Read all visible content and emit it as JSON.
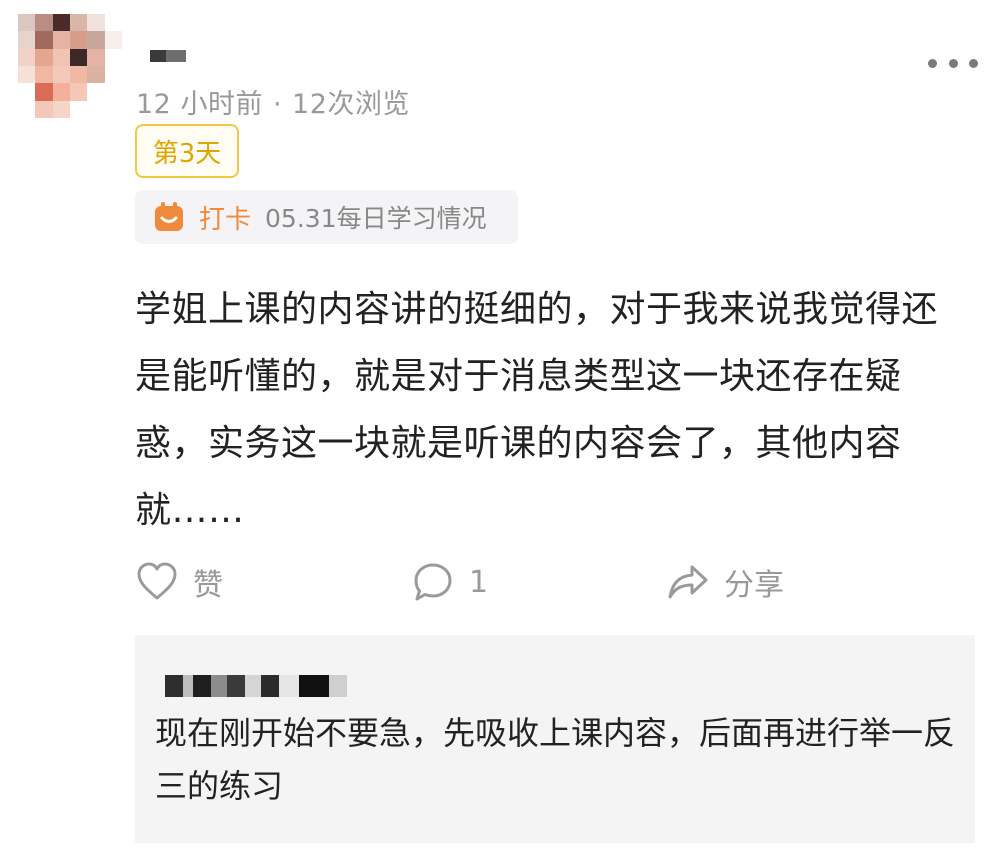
{
  "post": {
    "meta": {
      "time": "12 小时前",
      "separator": "·",
      "views": "12次浏览"
    },
    "day_badge": "第3天",
    "checkin": {
      "label": "打卡",
      "title": "05.31每日学习情况"
    },
    "text": "学姐上课的内容讲的挺细的，对于我来说我觉得还是能听懂的，就是对于消息类型这一块还存在疑惑，实务这一块就是听课的内容会了，其他内容就……",
    "actions": {
      "like": "赞",
      "comment_count": "1",
      "share": "分享"
    }
  },
  "reply": {
    "text": "现在刚开始不要急，先吸收上课内容，后面再进行举一反三的练习"
  },
  "icons": {
    "more": "more-dots-icon",
    "checkin": "calendar-icon",
    "like": "heart-icon",
    "comment": "comment-bubble-icon",
    "share": "share-arrow-icon"
  },
  "colors": {
    "badge_border": "#f0c844",
    "badge_text": "#e0a400",
    "checkin_accent": "#f08a3c",
    "muted": "#999999",
    "reply_bg": "#f4f4f4"
  }
}
